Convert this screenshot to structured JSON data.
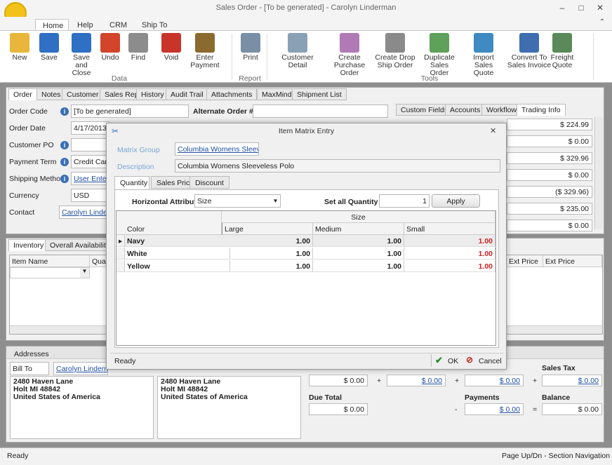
{
  "window": {
    "title": "Sales Order - [To be generated] - Carolyn Linderman"
  },
  "ribbon_tabs": [
    "Home",
    "Help",
    "CRM",
    "Ship To"
  ],
  "ribbon_buttons": [
    {
      "label": "New",
      "color": "#e8b63a"
    },
    {
      "label": "Save",
      "color": "#2f6fc4"
    },
    {
      "label": "Save and Close",
      "color": "#2f6fc4"
    },
    {
      "label": "Undo",
      "color": "#d2452a"
    },
    {
      "label": "Find",
      "color": "#8c8c8c"
    },
    {
      "label": "Void",
      "color": "#c9342a"
    },
    {
      "label": "Enter Payment",
      "color": "#8a6a2e"
    },
    {
      "label": "Print",
      "color": "#7a8fa6"
    },
    {
      "label": "Customer Detail",
      "color": "#8aa0b5"
    },
    {
      "label": "Create Purchase Order",
      "color": "#b07ab6"
    },
    {
      "label": "Create Drop Ship Order",
      "color": "#8a8a8a"
    },
    {
      "label": "Duplicate Sales Order",
      "color": "#5fa05a"
    },
    {
      "label": "Import Sales Quote",
      "color": "#3f8ac0"
    },
    {
      "label": "Convert To Sales Invoice",
      "color": "#3f6db0"
    },
    {
      "label": "Freight Quote",
      "color": "#5a8a5a"
    }
  ],
  "ribbon_groups": {
    "data": "Data",
    "report": "Report",
    "tools": "Tools"
  },
  "form_tabs": [
    "Order",
    "Notes",
    "Customer",
    "Sales Rep",
    "History",
    "Audit Trail",
    "Attachments",
    "MaxMind",
    "Shipment List"
  ],
  "fields": {
    "order_code_label": "Order Code",
    "order_code": "[To be generated]",
    "alt_order_label": "Alternate Order #",
    "order_date_label": "Order Date",
    "order_date": "4/17/2013",
    "customer_po_label": "Customer PO",
    "payment_term_label": "Payment Term",
    "payment_term": "Credit Card",
    "shipping_method_label": "Shipping Method",
    "shipping_method": "User Entered",
    "currency_label": "Currency",
    "currency": "USD",
    "contact_label": "Contact",
    "contact": "Carolyn Linderman"
  },
  "right_tabs": [
    "Custom Fields",
    "Accounts",
    "Workflow",
    "Trading Info"
  ],
  "right_values": [
    "$ 224.99",
    "$ 0.00",
    "$ 329.96",
    "$ 0.00",
    "($ 329.96)",
    "$ 235.00",
    "$ 0.00"
  ],
  "bottom_tabs": [
    "Inventory",
    "Overall Availability"
  ],
  "items_grid": {
    "col1": "Item Name",
    "col2": "Qua",
    "col3": "Ext Price",
    "col4": "Ext Price"
  },
  "addresses": {
    "header": "Addresses",
    "bill_to": "Bill To",
    "bill_contact": "Carolyn Linderman",
    "address_lines": [
      "2480 Haven Lane",
      "Holt MI 48842",
      "United States of America"
    ]
  },
  "totals": {
    "sales_tax_label": "Sales Tax",
    "due_total_label": "Due Total",
    "payments_label": "Payments",
    "balance_label": "Balance",
    "v1": "$ 0.00",
    "v2": "$ 0.00",
    "v3": "$ 0.00",
    "v4": "$ 0.00",
    "v5": "$ 0.00",
    "v6": "$ 0.00",
    "v7": "$ 0.00",
    "plus": "+",
    "minus": "-",
    "equals": "="
  },
  "status": {
    "left": "Ready",
    "right": "Page Up/Dn - Section Navigation"
  },
  "dialog": {
    "title": "Item Matrix Entry",
    "matrix_group_label": "Matrix Group",
    "matrix_group": "Columbia Womens Sleevel...",
    "description_label": "Description",
    "description": "Columbia Womens Sleeveless Polo",
    "tabs": [
      "Quantity",
      "Sales Price",
      "Discount"
    ],
    "horizontal_attribute_label": "Horizontal Attribute",
    "horizontal_attribute": "Size",
    "set_all_label": "Set all Quantity to",
    "set_all_value": "1",
    "apply": "Apply",
    "band_header": "Size",
    "columns": [
      "Color",
      "Large",
      "Medium",
      "Small"
    ],
    "rows": [
      {
        "color": "Navy",
        "large": "1.00",
        "medium": "1.00",
        "small": "1.00"
      },
      {
        "color": "White",
        "large": "1.00",
        "medium": "1.00",
        "small": "1.00"
      },
      {
        "color": "Yellow",
        "large": "1.00",
        "medium": "1.00",
        "small": "1.00"
      }
    ],
    "status": "Ready",
    "ok": "OK",
    "cancel": "Cancel"
  }
}
